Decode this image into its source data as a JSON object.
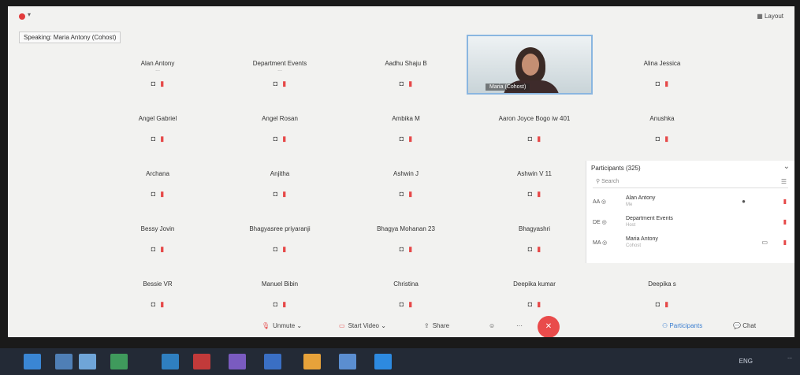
{
  "topbar": {
    "layout_label": "Layout"
  },
  "speaking": "Speaking: Maria Antony (Cohost)",
  "tiles": [
    {
      "name": "Alan Antony",
      "sub": "..."
    },
    {
      "name": "Department Events",
      "sub": "..."
    },
    {
      "name": "Aadhu Shaju B",
      "sub": ""
    },
    {
      "name": "",
      "sub": ""
    },
    {
      "name": "Alina Jessica",
      "sub": ""
    },
    {
      "name": "Angel Gabriel",
      "sub": ""
    },
    {
      "name": "Angel Rosan",
      "sub": ""
    },
    {
      "name": "Ambika M",
      "sub": ""
    },
    {
      "name": "Aaron Joyce Bogo iw 401",
      "sub": ""
    },
    {
      "name": "Anushka",
      "sub": ""
    },
    {
      "name": "Archana",
      "sub": ""
    },
    {
      "name": "Anjitha",
      "sub": ""
    },
    {
      "name": "Ashwin J",
      "sub": ""
    },
    {
      "name": "Ashwin V 11",
      "sub": ""
    },
    {
      "name": "",
      "sub": ""
    },
    {
      "name": "Bessy Jovin",
      "sub": ""
    },
    {
      "name": "Bhagyasree priyaranji",
      "sub": ""
    },
    {
      "name": "Bhagya Mohanan 23",
      "sub": ""
    },
    {
      "name": "Bhagyashri",
      "sub": ""
    },
    {
      "name": "",
      "sub": ""
    },
    {
      "name": "Bessie VR",
      "sub": ""
    },
    {
      "name": "Manuel Bibin",
      "sub": ""
    },
    {
      "name": "Christina",
      "sub": ""
    },
    {
      "name": "Deepika kumar",
      "sub": ""
    },
    {
      "name": "Deepika s",
      "sub": ""
    }
  ],
  "video": {
    "label": "Maria (Cohost)"
  },
  "participants": {
    "title": "Participants (325)",
    "search_placeholder": "Search",
    "rows": [
      {
        "initials": "AA",
        "name": "Alan Antony",
        "sub": "Me"
      },
      {
        "initials": "DE",
        "name": "Department Events",
        "sub": "Host"
      },
      {
        "initials": "MA",
        "name": "Maria Antony",
        "sub": "Cohost"
      }
    ]
  },
  "bottombar": {
    "unmute": "Unmute",
    "start_video": "Start Video",
    "share": "Share",
    "participants": "Participants",
    "chat": "Chat"
  },
  "taskbar": {
    "tray": "ENG",
    "time": "..."
  },
  "colors": {
    "accent": "#3c7fd0",
    "danger": "#e94b4b"
  }
}
